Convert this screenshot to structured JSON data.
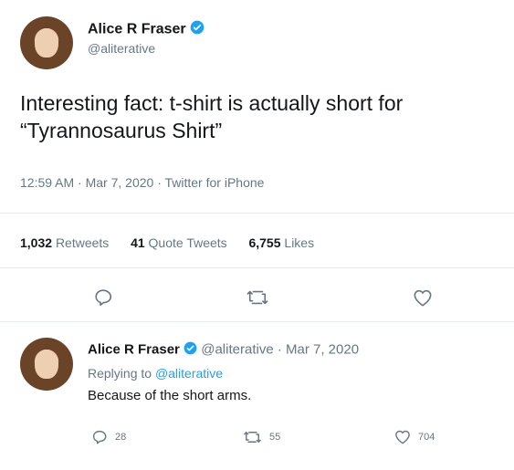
{
  "tweet": {
    "author": {
      "name": "Alice R Fraser",
      "handle": "@aliterative"
    },
    "text_line1": "Interesting fact: t-shirt is actually short for",
    "text_line2": "“Tyrannosaurus Shirt”",
    "meta": "12:59 AM · Mar 7, 2020 · Twitter for iPhone",
    "stats": {
      "retweets_count": "1,032",
      "retweets_label": "Retweets",
      "quotes_count": "41",
      "quotes_label": "Quote Tweets",
      "likes_count": "6,755",
      "likes_label": "Likes"
    }
  },
  "reply": {
    "author": {
      "name": "Alice R Fraser",
      "handle": "@aliterative",
      "date": "· Mar 7, 2020"
    },
    "replying_prefix": "Replying to",
    "replying_handle": "@aliterative",
    "text": "Because of the short arms.",
    "counts": {
      "replies": "28",
      "retweets": "55",
      "likes": "704"
    }
  },
  "colors": {
    "accent": "#1da1f2",
    "muted": "#657786",
    "text": "#14171a",
    "divider": "#e6ecf0"
  },
  "icons": [
    "verified-badge-icon",
    "reply-icon",
    "retweet-icon",
    "like-icon"
  ]
}
